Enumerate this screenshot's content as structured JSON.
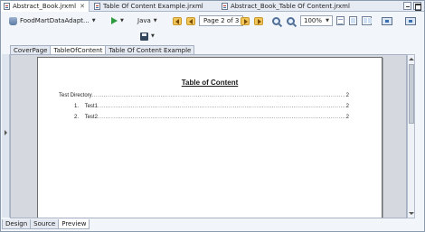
{
  "editor_tabs": [
    {
      "label": "Abstract_Book.jrxml",
      "active": true,
      "close": "✕"
    },
    {
      "label": "Table Of Content Example.jrxml",
      "active": false
    },
    {
      "label": "Abstract_Book_Table Of Content.jrxml",
      "active": false
    }
  ],
  "toolbar": {
    "datasource": "FoodMartDataAdapt...",
    "language": "Java",
    "page_indicator": "Page 2 of 3",
    "zoom": "100%",
    "dropdown_glyph": "▼"
  },
  "report_tabs": [
    {
      "label": "CoverPage",
      "active": false
    },
    {
      "label": "TableOfContent",
      "active": true
    },
    {
      "label": "Table Of Content Example",
      "active": false
    }
  ],
  "document": {
    "title": "Table of Content",
    "entries": [
      {
        "label": "Test Directory",
        "page": "2"
      },
      {
        "label": "1.    Test1",
        "page": "2"
      },
      {
        "label": "2.    Test2",
        "page": "2"
      }
    ]
  },
  "bottom_tabs": [
    {
      "label": "Design",
      "active": false
    },
    {
      "label": "Source",
      "active": false
    },
    {
      "label": "Preview",
      "active": true
    }
  ]
}
